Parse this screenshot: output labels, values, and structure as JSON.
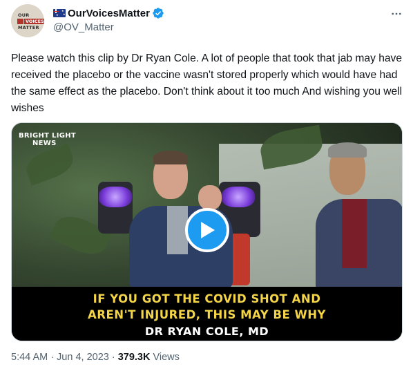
{
  "author": {
    "display_name": "OurVoicesMatter",
    "handle": "@OV_Matter",
    "avatar_text": [
      "OUR",
      "VOICES",
      "MATTER"
    ]
  },
  "tweet": {
    "text": "Please watch this clip by Dr Ryan Cole. A lot of people that took that jab may have received the placebo or the vaccine wasn't stored properly which would have had the same effect as the placebo. Don't think about it too much And wishing you well wishes"
  },
  "video": {
    "logo_line1": "BRIGHT LIGHT",
    "logo_line2": "NEWS",
    "caption_line1": "IF YOU GOT THE COVID SHOT AND",
    "caption_line2": "AREN'T INJURED, THIS MAY BE WHY",
    "caption_line3": "DR RYAN COLE, MD"
  },
  "meta": {
    "time": "5:44 AM",
    "date": "Jun 4, 2023",
    "views_count": "379.3K",
    "views_label": "Views"
  },
  "colors": {
    "accent": "#1d9bf0",
    "text_primary": "#0f1419",
    "text_secondary": "#536471",
    "caption_yellow": "#f4d548"
  }
}
